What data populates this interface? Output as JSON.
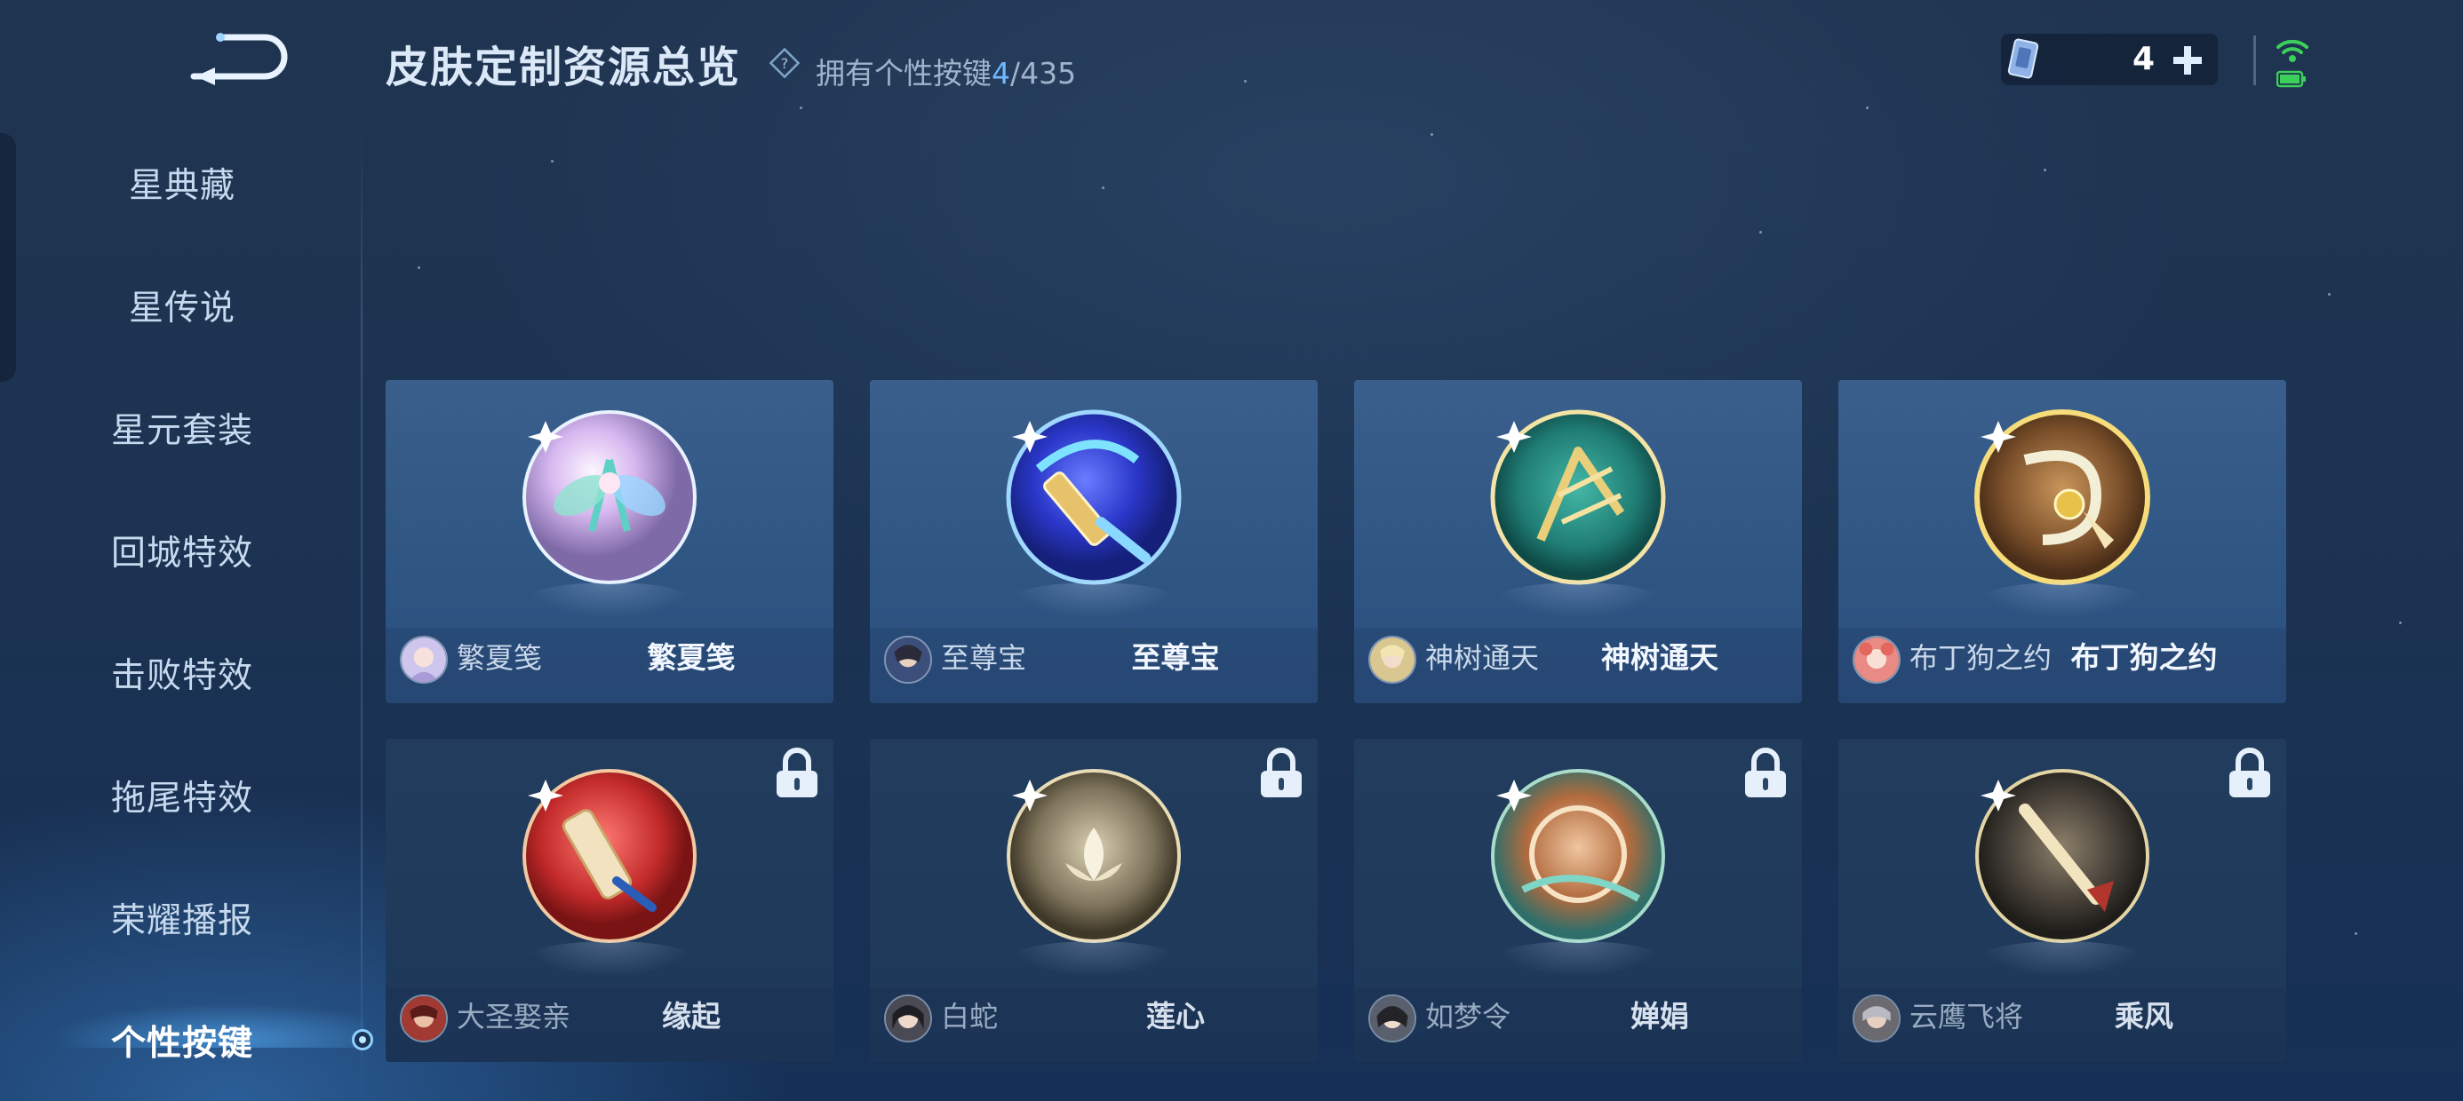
{
  "header": {
    "title": "皮肤定制资源总览",
    "owned_prefix": "拥有个性按键",
    "owned_count": "4",
    "owned_total": "/435"
  },
  "currency": {
    "count": "4"
  },
  "sidebar": {
    "items": [
      {
        "label": "星典藏"
      },
      {
        "label": "星传说"
      },
      {
        "label": "星元套装"
      },
      {
        "label": "回城特效"
      },
      {
        "label": "击败特效"
      },
      {
        "label": "拖尾特效"
      },
      {
        "label": "荣耀播报"
      },
      {
        "label": "个性按键",
        "active": true
      }
    ]
  },
  "cards": [
    {
      "hero": "繁夏笺",
      "skin": "繁夏笺",
      "locked": false
    },
    {
      "hero": "至尊宝",
      "skin": "至尊宝",
      "locked": false
    },
    {
      "hero": "神树通天",
      "skin": "神树通天",
      "locked": false
    },
    {
      "hero": "布丁狗之约",
      "skin": "布丁狗之约",
      "locked": false
    },
    {
      "hero": "大圣娶亲",
      "skin": "缘起",
      "locked": true
    },
    {
      "hero": "白蛇",
      "skin": "莲心",
      "locked": true
    },
    {
      "hero": "如梦令",
      "skin": "婵娟",
      "locked": true
    },
    {
      "hero": "云鹰飞将",
      "skin": "乘风",
      "locked": true
    }
  ],
  "colors": {
    "accent": "#6fb8ff",
    "card_unlocked": "#325783",
    "card_locked": "#203b5c",
    "background": "#1c3352"
  }
}
